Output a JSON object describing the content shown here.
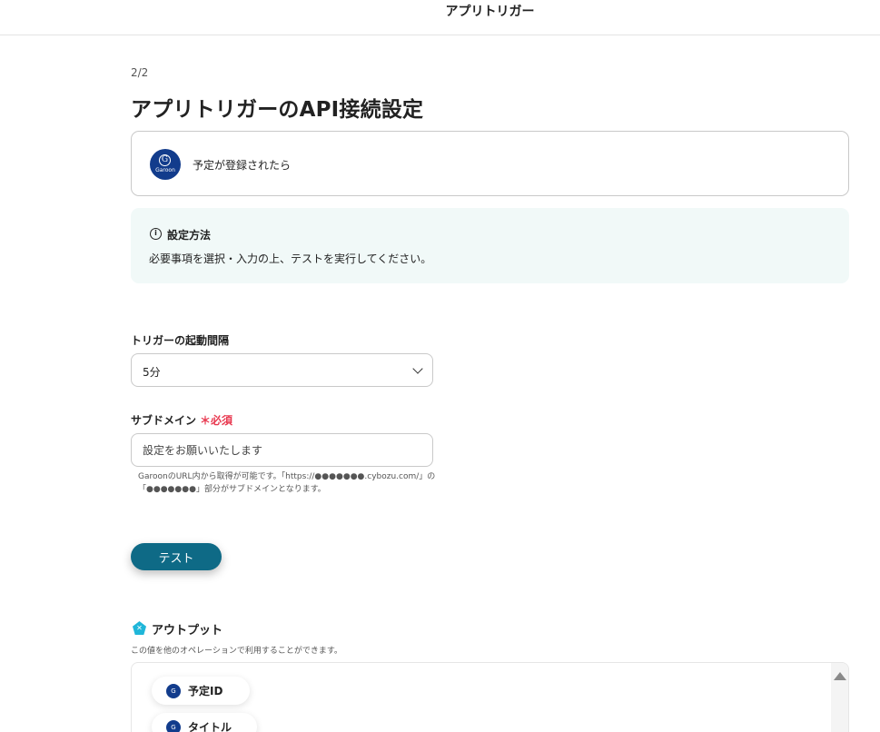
{
  "header": {
    "title": "アプリトリガー"
  },
  "step": "2/2",
  "page_title": "アプリトリガーのAPI接続設定",
  "app_card": {
    "logo_letter": "G",
    "logo_brand": "Garoon",
    "event": "予定が登録されたら"
  },
  "info": {
    "icon": "info-icon",
    "heading": "設定方法",
    "text": "必要事項を選択・入力の上、テストを実行してください。"
  },
  "interval": {
    "label": "トリガーの起動間隔",
    "value": "5分"
  },
  "subdomain": {
    "label": "サブドメイン",
    "required": "＊必須",
    "placeholder": "設定をお願いいたします",
    "help": "GaroonのURL内から取得が可能です。「https://●●●●●●●.cybozu.com/」の「●●●●●●●」部分がサブドメインとなります。"
  },
  "test_button": "テスト",
  "output": {
    "title": "アウトプット",
    "description": "この値を他のオペレーションで利用することができます。",
    "items": [
      "予定ID",
      "タイトル"
    ]
  },
  "colors": {
    "accent": "#0e6a86",
    "garoon_blue": "#123c8c",
    "required_red": "#e8384f",
    "info_bg": "#f1f9f8",
    "output_icon": "#1fb6d9"
  }
}
